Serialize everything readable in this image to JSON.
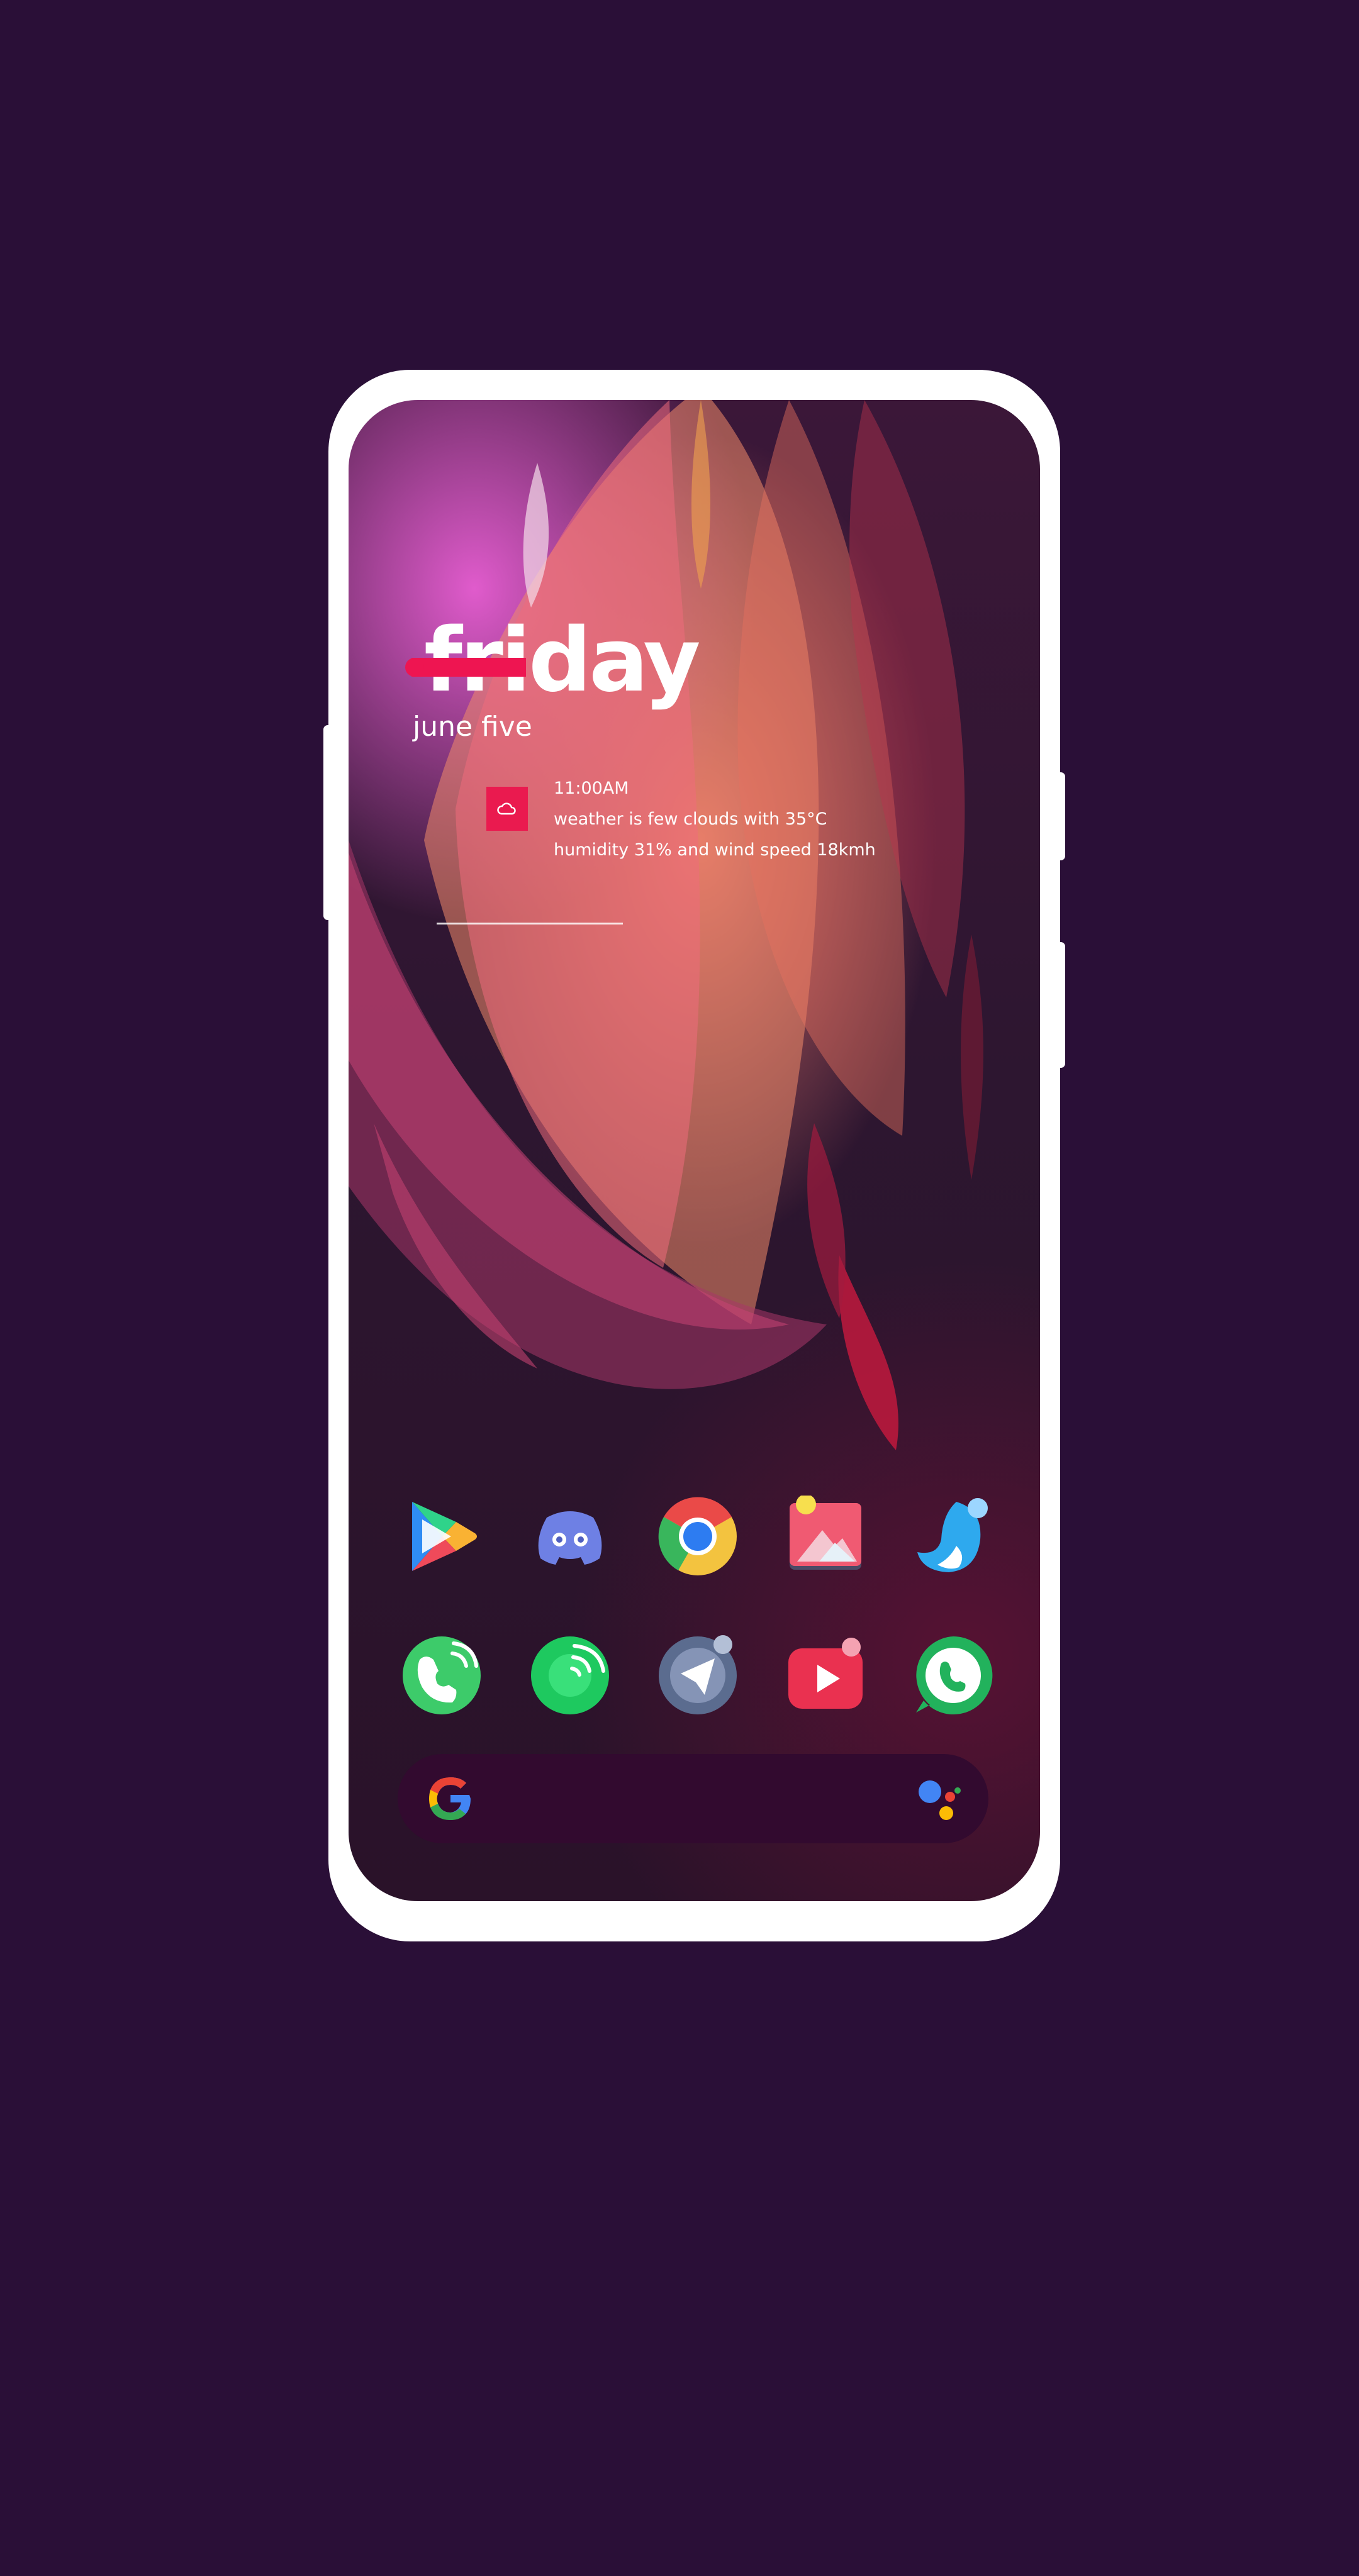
{
  "widget": {
    "day": "friday",
    "date": "june five",
    "weather_icon": "cloud-icon",
    "time": "11:00AM",
    "weather": "weather is few clouds with 35°C",
    "humidity": "humidity 31% and wind speed 18kmh"
  },
  "dock": {
    "row1": [
      {
        "name": "play-store-icon"
      },
      {
        "name": "discord-icon"
      },
      {
        "name": "chrome-icon"
      },
      {
        "name": "gallery-icon"
      },
      {
        "name": "twitter-icon"
      }
    ],
    "row2": [
      {
        "name": "phone-dialer-icon"
      },
      {
        "name": "spotify-icon"
      },
      {
        "name": "telegram-icon"
      },
      {
        "name": "youtube-icon"
      },
      {
        "name": "whatsapp-icon"
      }
    ]
  },
  "search_bar": {
    "logo": "google-g-icon",
    "assistant": "google-assistant-icon"
  },
  "colors": {
    "background": "#2a0f37",
    "accent": "#ee1551",
    "search_bar": "#320a2f"
  }
}
